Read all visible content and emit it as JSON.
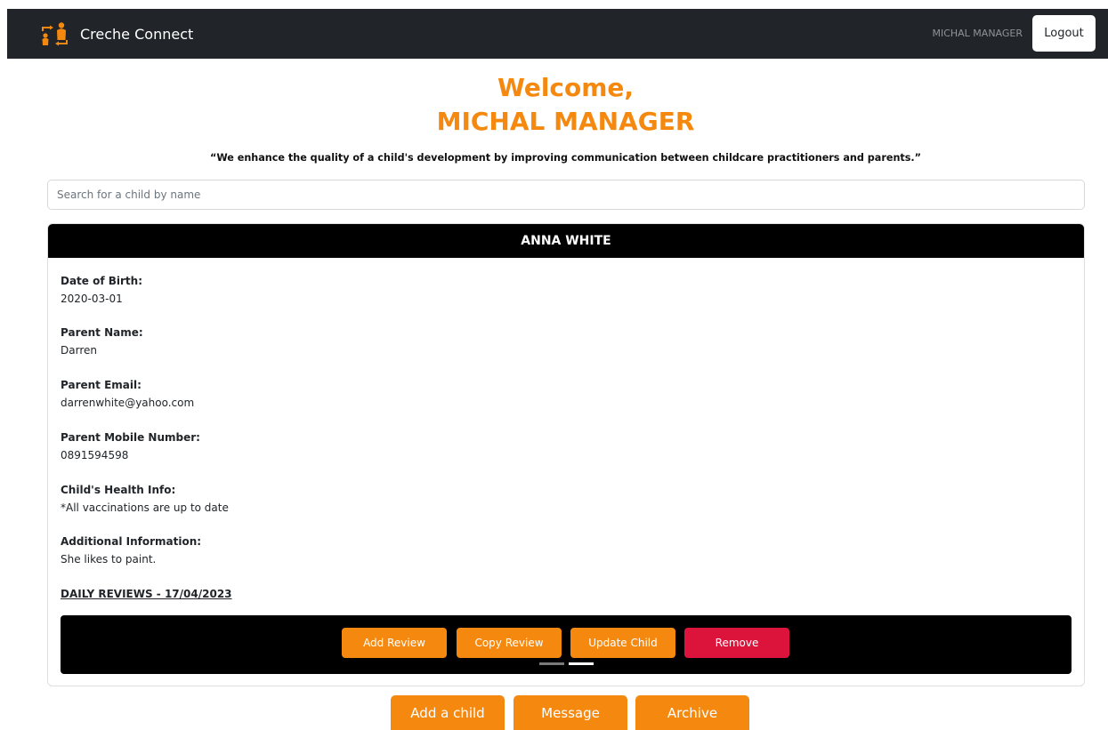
{
  "navbar": {
    "brand_name": "Creche Connect",
    "user_name": "MICHAL MANAGER",
    "logout_label": "Logout"
  },
  "welcome": {
    "line1": "Welcome,",
    "line2": "MICHAL MANAGER",
    "quote": "“We enhance the quality of a child's development by improving communication between childcare practitioners and parents.”"
  },
  "search": {
    "placeholder": "Search for a child by name",
    "value": ""
  },
  "child": {
    "name": "ANNA WHITE",
    "fields": [
      {
        "label": "Date of Birth:",
        "value": "2020-03-01"
      },
      {
        "label": "Parent Name:",
        "value": "Darren"
      },
      {
        "label": "Parent Email:",
        "value": "darrenwhite@yahoo.com"
      },
      {
        "label": "Parent Mobile Number:",
        "value": "0891594598"
      },
      {
        "label": "Child's Health Info:",
        "value": "*All vaccinations are up to date"
      },
      {
        "label": "Additional Information:",
        "value": "She likes to paint."
      }
    ],
    "reviews_label": "DAILY REVIEWS - 17/04/2023"
  },
  "review_actions": {
    "add_review": "Add Review",
    "copy_review": "Copy Review",
    "update_child": "Update Child",
    "remove": "Remove"
  },
  "carousel": {
    "slide_count": 2,
    "active_index": 1
  },
  "bottom_actions": {
    "add_child": "Add a child",
    "message": "Message",
    "archive": "Archive"
  },
  "colors": {
    "accent": "#f5890f",
    "danger": "#dc143c",
    "navbar": "#212529",
    "card_header": "#000000"
  },
  "icons": {
    "brand": "creche-logo-icon"
  }
}
